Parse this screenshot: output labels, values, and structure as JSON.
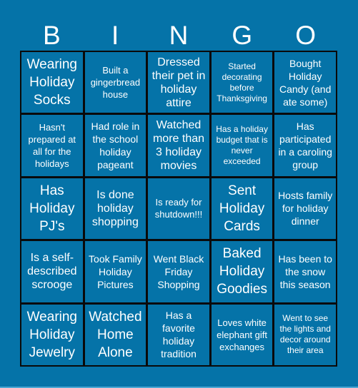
{
  "header": {
    "letters": [
      "B",
      "I",
      "N",
      "G",
      "O"
    ]
  },
  "colors": {
    "background": "#0573a8",
    "grid_lines": "#0a0a0a",
    "text": "#ffffff"
  },
  "board": {
    "cells": [
      {
        "text": "Wearing Holiday Socks",
        "size": "xl"
      },
      {
        "text": "Built a gingerbread house",
        "size": "sm"
      },
      {
        "text": "Dressed their pet in holiday attire",
        "size": "lg"
      },
      {
        "text": "Started decorating before Thanksgiving",
        "size": "xs"
      },
      {
        "text": "Bought Holiday Candy (and ate some)",
        "size": "md"
      },
      {
        "text": "Hasn't prepared at all for the holidays",
        "size": "sm"
      },
      {
        "text": "Had role in the school holiday pageant",
        "size": "md"
      },
      {
        "text": "Watched more than 3 holiday movies",
        "size": "lg"
      },
      {
        "text": "Has a holiday budget that is never exceeded",
        "size": "xs"
      },
      {
        "text": "Has participated in a caroling group",
        "size": "md"
      },
      {
        "text": "Has Holiday PJ's",
        "size": "xl"
      },
      {
        "text": "Is done holiday shopping",
        "size": "lg"
      },
      {
        "text": "Is ready for shutdown!!!",
        "size": "sm"
      },
      {
        "text": "Sent Holiday Cards",
        "size": "xl"
      },
      {
        "text": "Hosts family for holiday dinner",
        "size": "md"
      },
      {
        "text": "Is a self-described scrooge",
        "size": "lg"
      },
      {
        "text": "Took Family Holiday Pictures",
        "size": "md"
      },
      {
        "text": "Went Black Friday Shopping",
        "size": "md"
      },
      {
        "text": "Baked Holiday Goodies",
        "size": "xl"
      },
      {
        "text": "Has been to the snow this season",
        "size": "md"
      },
      {
        "text": "Wearing Holiday Jewelry",
        "size": "xl"
      },
      {
        "text": "Watched Home Alone",
        "size": "xl"
      },
      {
        "text": "Has a favorite holiday tradition",
        "size": "md"
      },
      {
        "text": "Loves white elephant gift exchanges",
        "size": "sm"
      },
      {
        "text": "Went to see the lights and decor around their area",
        "size": "xs"
      }
    ]
  }
}
